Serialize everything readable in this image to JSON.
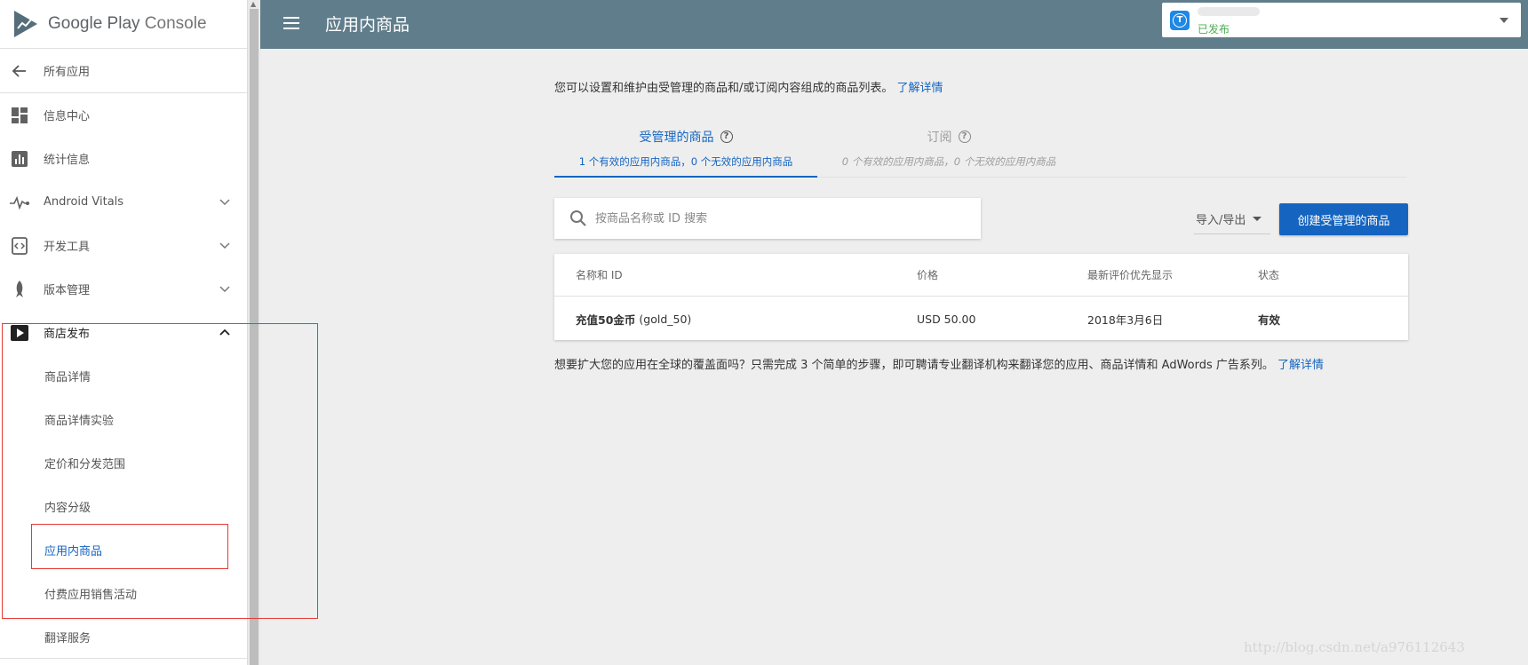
{
  "brand": {
    "name": "Google Play",
    "product": "Console"
  },
  "header": {
    "title": "应用内商品",
    "app_status": "已发布",
    "app_avatar_letter": "T"
  },
  "sidebar": {
    "back": "所有应用",
    "items": [
      {
        "label": "信息中心"
      },
      {
        "label": "统计信息"
      },
      {
        "label": "Android Vitals"
      },
      {
        "label": "开发工具"
      },
      {
        "label": "版本管理"
      },
      {
        "label": "商店发布"
      }
    ],
    "sub_items": [
      {
        "label": "商品详情"
      },
      {
        "label": "商品详情实验"
      },
      {
        "label": "定价和分发范围"
      },
      {
        "label": "内容分级"
      },
      {
        "label": "应用内商品"
      },
      {
        "label": "付费应用销售活动"
      },
      {
        "label": "翻译服务"
      }
    ]
  },
  "main": {
    "intro": "您可以设置和维护由受管理的商品和/或订阅内容组成的商品列表。",
    "intro_link": "了解详情",
    "tabs": [
      {
        "title": "受管理的商品",
        "subtitle": "1 个有效的应用内商品，0 个无效的应用内商品"
      },
      {
        "title": "订阅",
        "subtitle": "0 个有效的应用内商品，0 个无效的应用内商品"
      }
    ],
    "search_placeholder": "按商品名称或 ID 搜索",
    "import_export": "导入/导出",
    "create_button": "创建受管理的商品",
    "table": {
      "headers": [
        "名称和 ID",
        "价格",
        "最新评价优先显示",
        "状态"
      ],
      "rows": [
        {
          "name": "充值50金币",
          "id": "(gold_50)",
          "price": "USD 50.00",
          "date": "2018年3月6日",
          "status": "有效"
        }
      ]
    },
    "bottom_note": "想要扩大您的应用在全球的覆盖面吗？只需完成 3 个简单的步骤，即可聘请专业翻译机构来翻译您的应用、商品详情和 AdWords 广告系列。",
    "bottom_link": "了解详情"
  },
  "watermark": "http://blog.csdn.net/a976112643",
  "colors": {
    "topbar": "#607d8b",
    "accent": "#1565c0",
    "published": "#4caf50",
    "annotation": "#e53935"
  }
}
